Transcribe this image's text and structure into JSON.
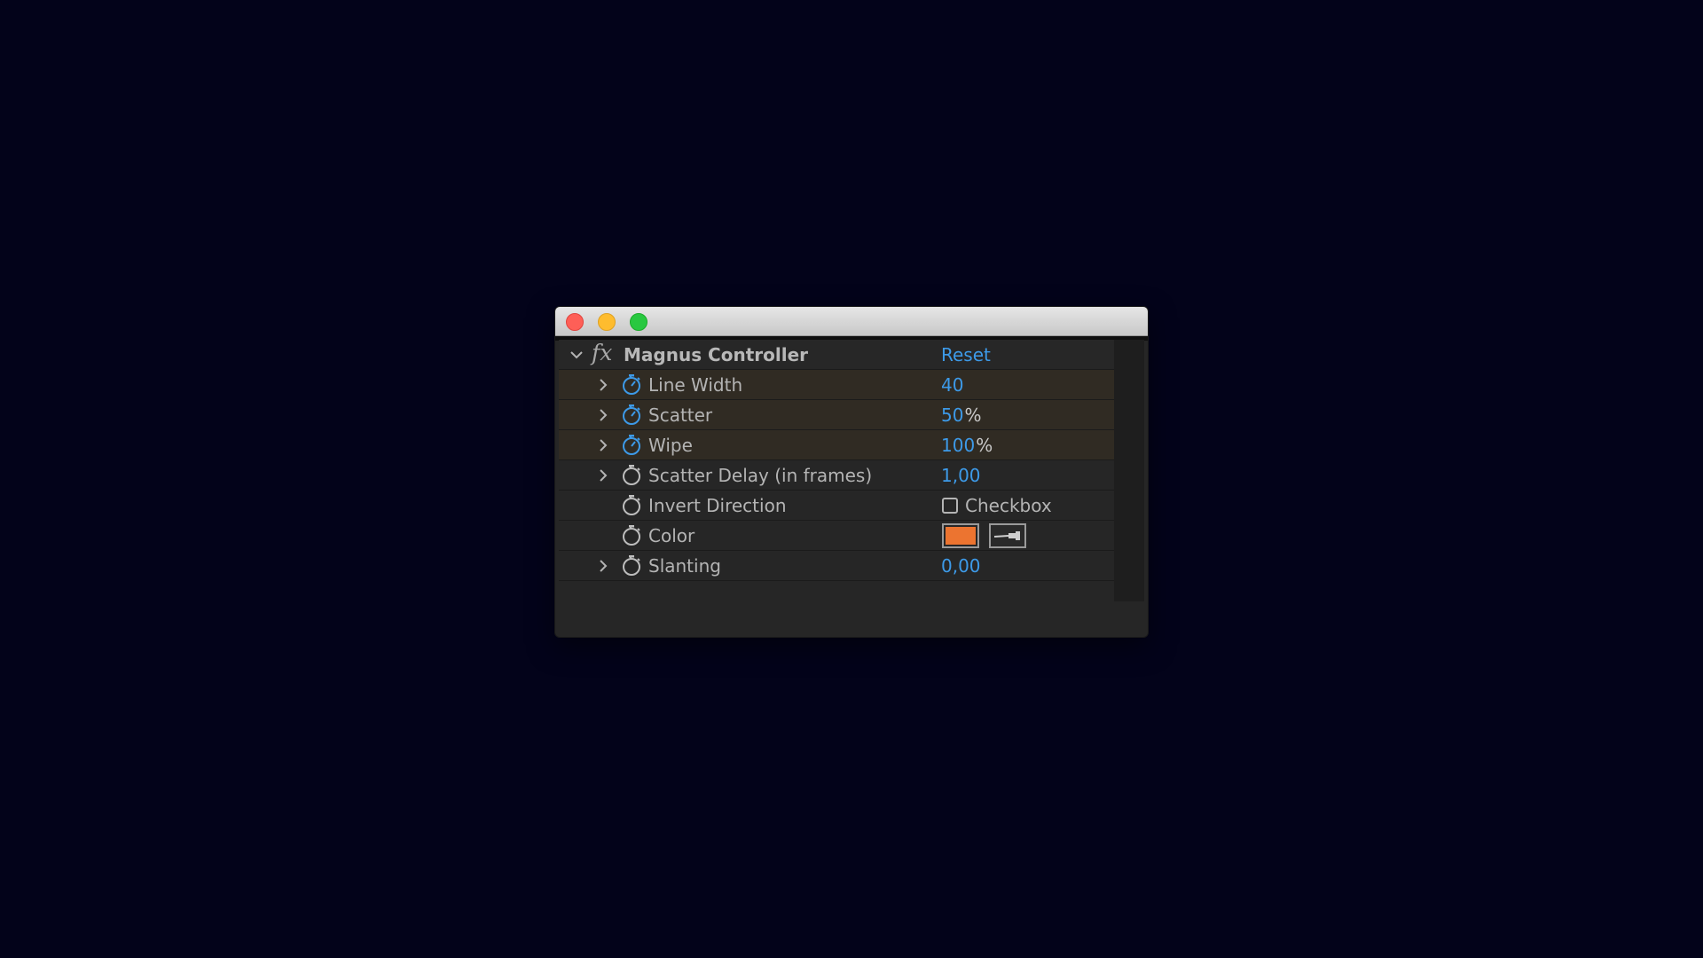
{
  "effect": {
    "name": "Magnus Controller",
    "fx_symbol": "fx",
    "reset_label": "Reset"
  },
  "params": [
    {
      "name": "Line Width",
      "value": "40",
      "unit": "",
      "animated": true,
      "expandable": true
    },
    {
      "name": "Scatter",
      "value": "50",
      "unit": "%",
      "animated": true,
      "expandable": true
    },
    {
      "name": "Wipe",
      "value": "100",
      "unit": "%",
      "animated": true,
      "expandable": true
    },
    {
      "name": "Scatter Delay (in frames)",
      "value": "1,00",
      "unit": "",
      "animated": false,
      "expandable": true
    },
    {
      "name": "Invert Direction",
      "checkbox_label": "Checkbox",
      "checked": false,
      "animated": false,
      "expandable": false
    },
    {
      "name": "Color",
      "color": "#ec7430",
      "animated": false,
      "expandable": false
    },
    {
      "name": "Slanting",
      "value": "0,00",
      "unit": "",
      "animated": false,
      "expandable": true
    }
  ],
  "colors": {
    "value_blue": "#3d9ae8",
    "stopwatch_active": "#3d9ae8",
    "stopwatch_inactive": "#bdbdbd",
    "animated_row_bg": "#302b23",
    "swatch_color": "#ec7430"
  },
  "icons": {
    "close": "close-button",
    "minimize": "minimize-button",
    "maximize": "maximize-button",
    "twirl_open": "chevron-down-icon",
    "twirl_closed": "chevron-right-icon",
    "stopwatch": "stopwatch-icon",
    "eyedropper": "eyedropper-icon"
  }
}
